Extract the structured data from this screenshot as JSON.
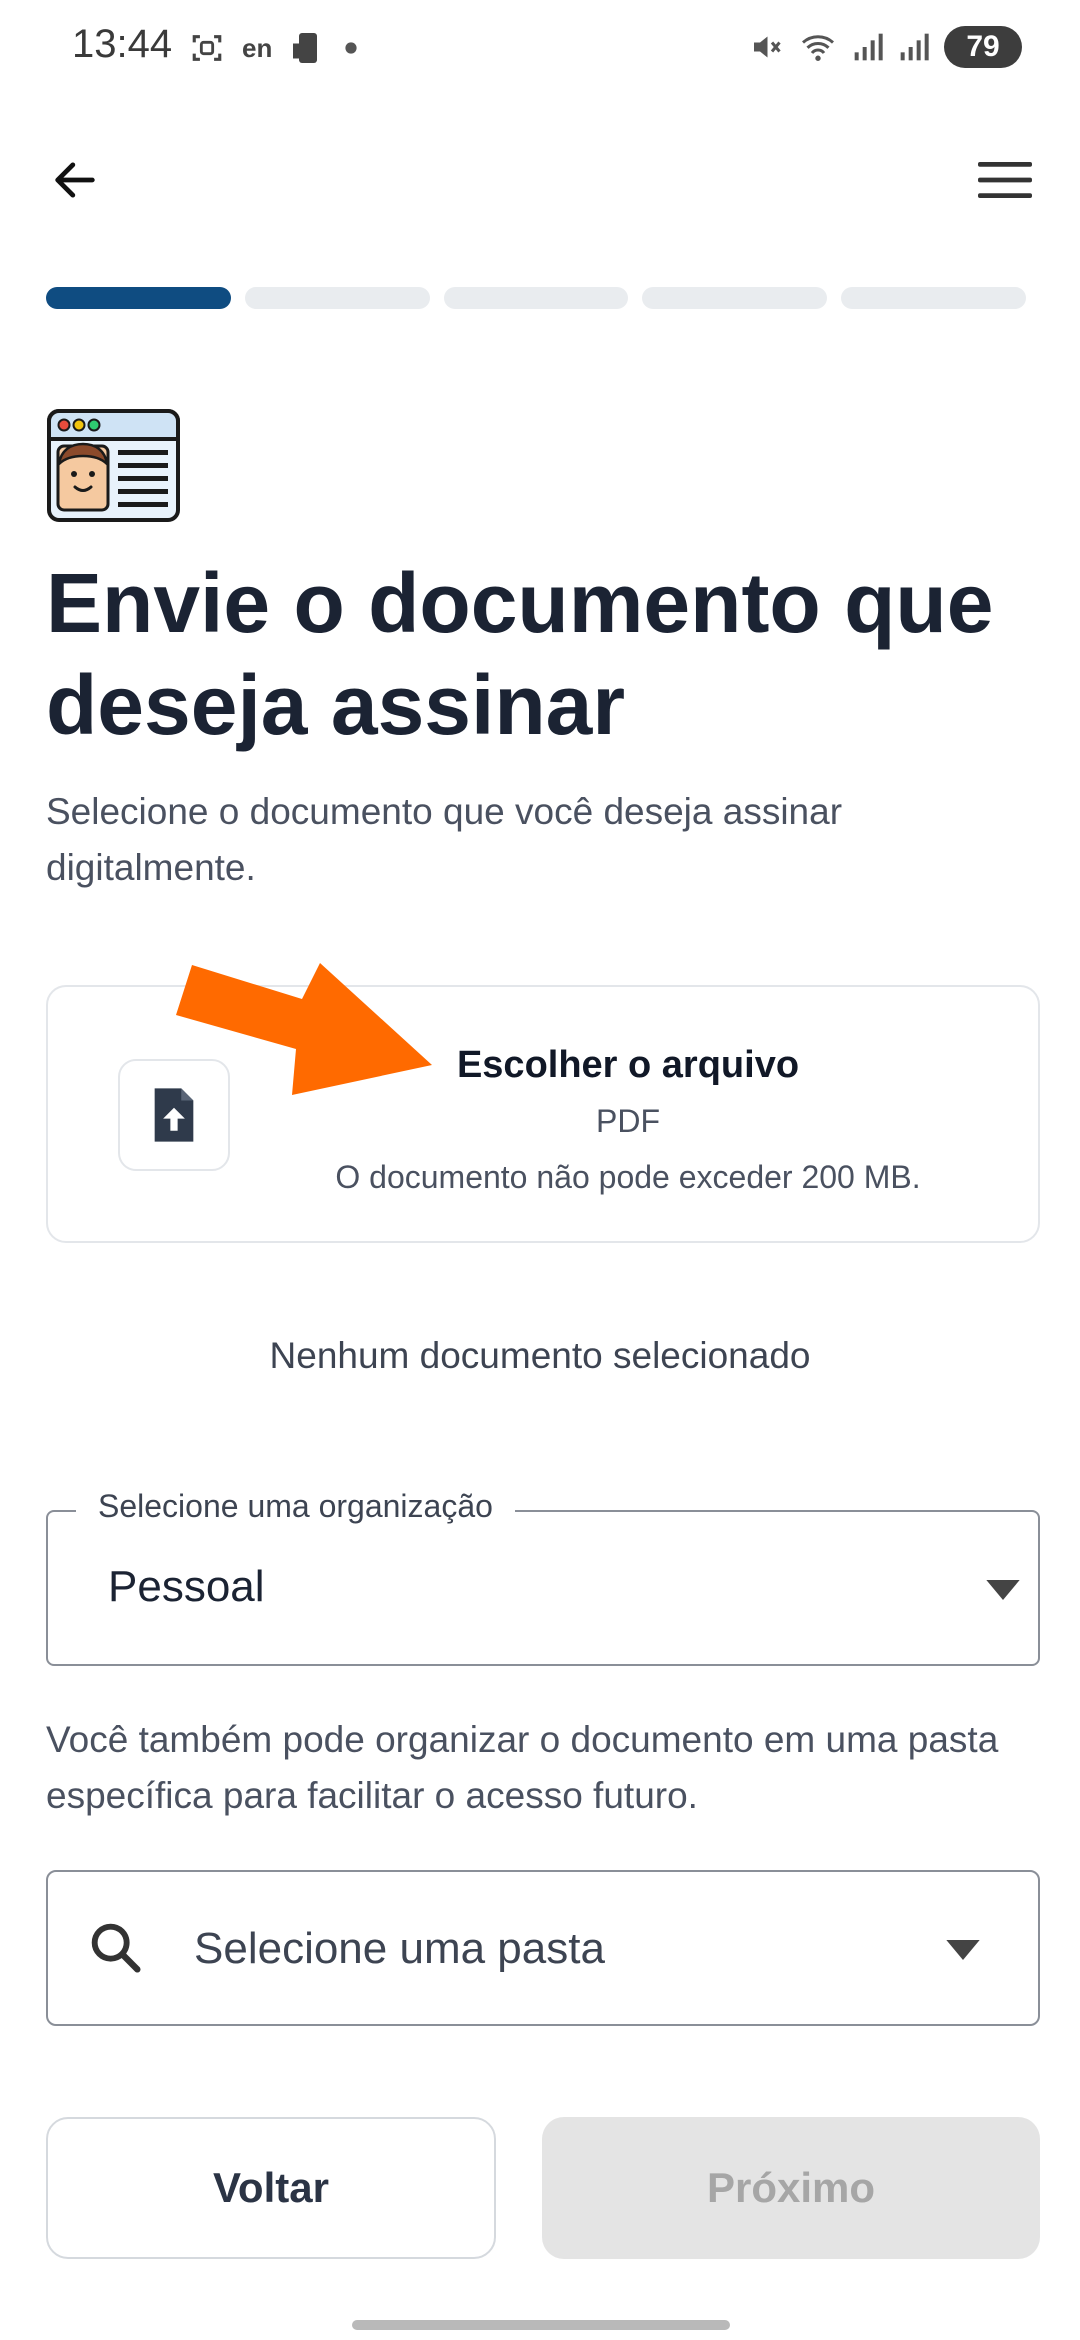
{
  "status_bar": {
    "time": "13:44",
    "left_icons": [
      "screenshot-icon",
      "translate-icon",
      "phone-icon",
      "dot"
    ],
    "lang_label": "en",
    "right_icons": [
      "mute-icon",
      "wifi-icon",
      "signal-icon",
      "signal-icon"
    ],
    "battery": "79"
  },
  "app_bar": {
    "back_icon": "arrow-left-icon",
    "menu_icon": "hamburger-menu-icon"
  },
  "stepper": {
    "total_steps": 5,
    "current_step": 1,
    "active_color": "#0f4c81",
    "inactive_color": "#e9ecef"
  },
  "header": {
    "title": "Envie o documento que deseja assinar",
    "subtitle": "Selecione o documento que você deseja assinar digitalmente."
  },
  "upload": {
    "title": "Escolher o arquivo",
    "type": "PDF",
    "limit": "O documento não pode exceder 200 MB.",
    "icon": "file-upload-icon"
  },
  "annotation_arrow_color": "#ff6a00",
  "selection_status": "Nenhum documento selecionado",
  "organization": {
    "label": "Selecione uma organização",
    "value": "Pessoal"
  },
  "helper_text": "Você também pode organizar o documento em uma pasta específica para facilitar o acesso futuro.",
  "folder": {
    "placeholder": "Selecione uma pasta"
  },
  "actions": {
    "back_label": "Voltar",
    "next_label": "Próximo"
  }
}
